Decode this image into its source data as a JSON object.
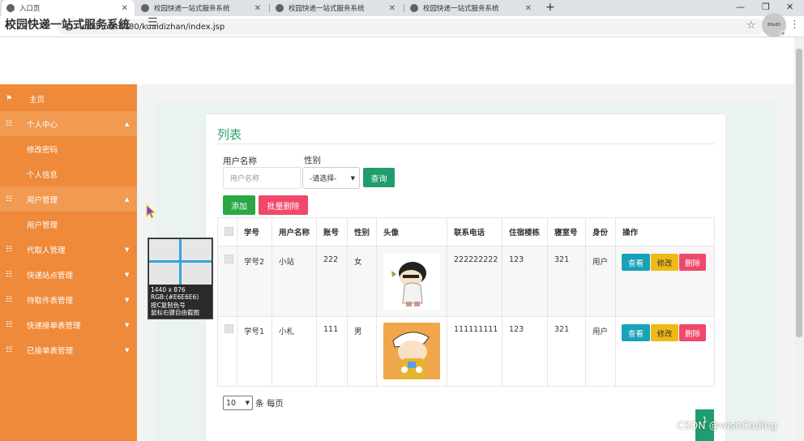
{
  "browser": {
    "tabs": [
      {
        "title": "入口页",
        "active": true
      },
      {
        "title": "校园快递一站式服务系统",
        "active": false
      },
      {
        "title": "校园快递一站式服务系统",
        "active": false
      },
      {
        "title": "校园快递一站式服务系统",
        "active": false
      }
    ],
    "new_tab": "+",
    "url": "localhost:8080/kuaidizhan/index.jsp"
  },
  "header": {
    "title": "校园快递一站式服务系统",
    "avatar_text": "80x80"
  },
  "sidebar": {
    "items": [
      {
        "label": "主页",
        "icon": "flag-icon",
        "caret": false
      },
      {
        "label": "个人中心",
        "icon": "grid-icon",
        "caret": true
      },
      {
        "label": "修改密码",
        "icon": "",
        "caret": false
      },
      {
        "label": "个人信息",
        "icon": "",
        "caret": false
      },
      {
        "label": "用户管理",
        "icon": "grid-icon",
        "caret": true
      },
      {
        "label": "用户管理",
        "icon": "",
        "caret": false
      },
      {
        "label": "代取人管理",
        "icon": "grid-icon",
        "caret": true
      },
      {
        "label": "快递站点管理",
        "icon": "grid-icon",
        "caret": true
      },
      {
        "label": "待取件表管理",
        "icon": "grid-icon",
        "caret": true
      },
      {
        "label": "快递接单表管理",
        "icon": "grid-icon",
        "caret": true
      },
      {
        "label": "已接单表管理",
        "icon": "grid-icon",
        "caret": true
      }
    ]
  },
  "main": {
    "title": "列表",
    "search": {
      "username_label": "用户名称",
      "username_placeholder": "用户名称",
      "gender_label": "性别",
      "gender_selected": "-请选择-",
      "query_button": "查询"
    },
    "add_button": "添加",
    "batch_delete_button": "批量删除",
    "table": {
      "columns": [
        "学号",
        "用户名称",
        "账号",
        "性别",
        "头像",
        "联系电话",
        "住宿楼栋",
        "寝室号",
        "身份",
        "操作"
      ],
      "rows": [
        {
          "id": "学号2",
          "name": "小站",
          "account": "222",
          "gender": "女",
          "phone": "222222222",
          "building": "123",
          "room": "321",
          "role": "用户"
        },
        {
          "id": "学号1",
          "name": "小札",
          "account": "111",
          "gender": "男",
          "phone": "111111111",
          "building": "123",
          "room": "321",
          "role": "用户"
        }
      ],
      "actions": {
        "view": "查看",
        "edit": "修改",
        "delete": "删除"
      }
    },
    "pagination": {
      "page_size": "10",
      "page_size_label": "条 每页",
      "current_page": "1"
    }
  },
  "overlay": {
    "magnifier_lines": [
      "1440 x 876",
      "RGB:(#E6E6E6)",
      "按C复制色号",
      "鼠标右键自由截图"
    ]
  },
  "watermark": "CSDN @wishCoding",
  "colors": {
    "sidebar": "#ee8a3a",
    "accent_green": "#1f9d6c",
    "danger": "#f0476b",
    "info": "#17a2b8",
    "warning": "#f0b914"
  }
}
